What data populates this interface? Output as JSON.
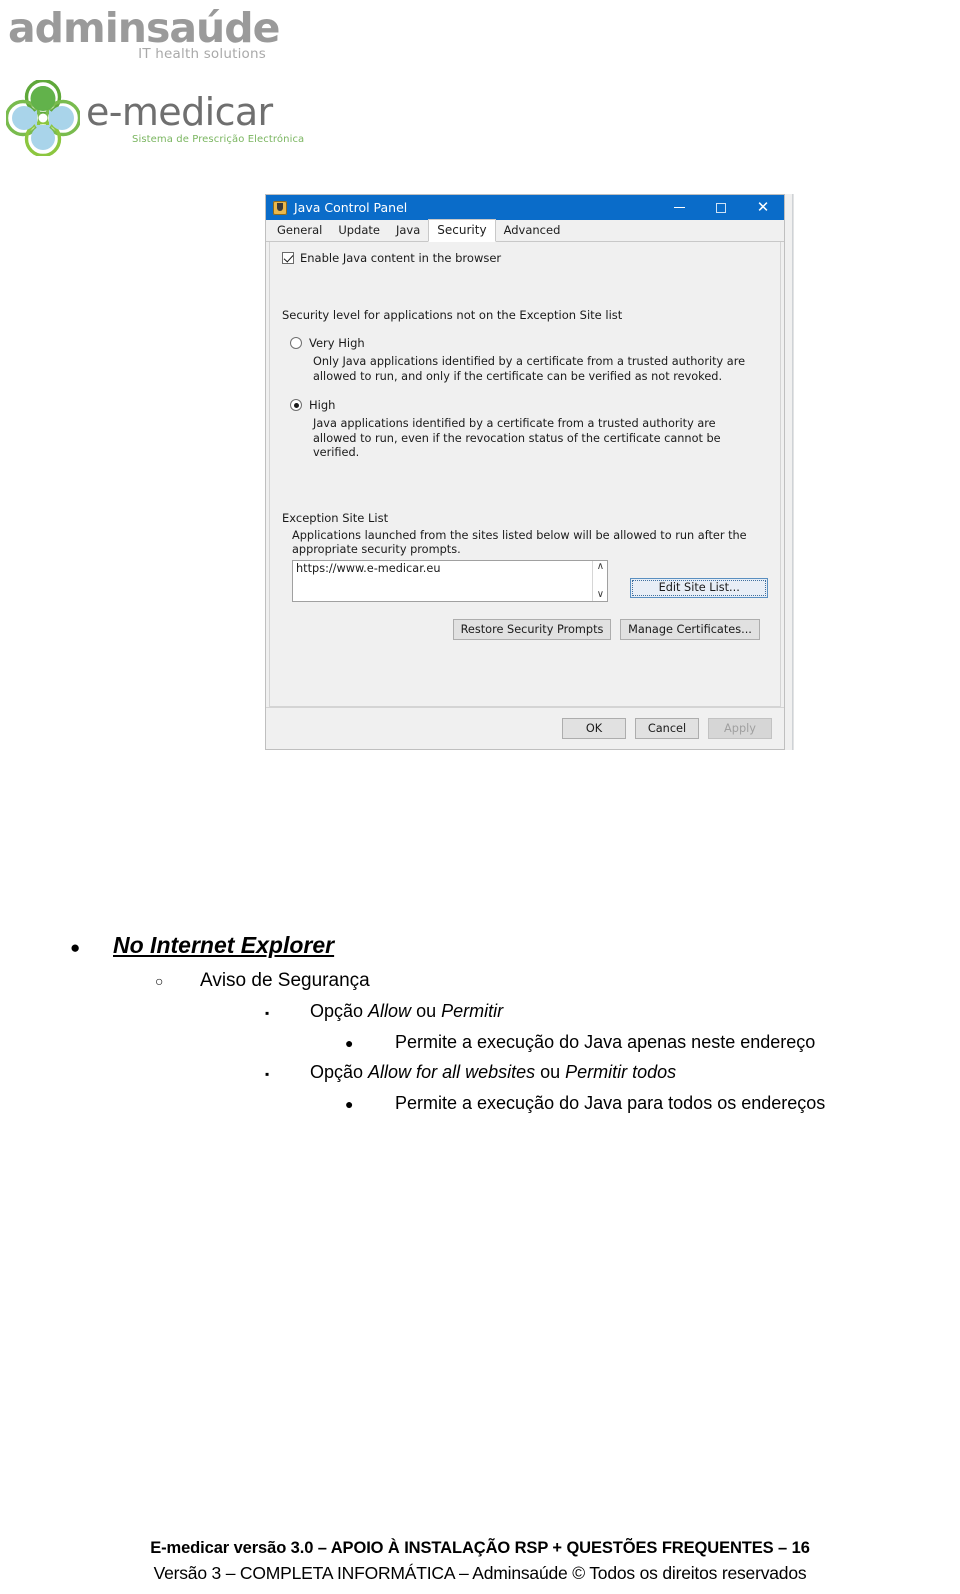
{
  "logos": {
    "adminsaude": {
      "brand": "adminsaúde",
      "tagline": "IT health solutions",
      "color": "#9a9a9a"
    },
    "emedicar": {
      "word": "e-medicar",
      "subtitle": "Sistema de Prescrição Electrónica",
      "mark_icon": "four-petal-flower-icon",
      "petal_green": "#6cb33f",
      "petal_blue": "#9ccfe8",
      "ring_green": "#5fa83a",
      "word_color": "#6f6f6f",
      "subtitle_color": "#7bb661"
    }
  },
  "java_control_panel": {
    "title": "Java Control Panel",
    "title_icon": "java-coffee-cup-icon",
    "titlebar_color": "#0a6cc9",
    "window_buttons": {
      "minimize": "minimize-icon",
      "maximize": "maximize-icon",
      "close": "✕"
    },
    "tabs": [
      {
        "label": "General",
        "active": false
      },
      {
        "label": "Update",
        "active": false
      },
      {
        "label": "Java",
        "active": false
      },
      {
        "label": "Security",
        "active": true
      },
      {
        "label": "Advanced",
        "active": false
      }
    ],
    "enable_java": {
      "label": "Enable Java content in the browser",
      "checked": true
    },
    "security_level": {
      "heading": "Security level for applications not on the Exception Site list",
      "options": [
        {
          "label": "Very High",
          "selected": false,
          "description": "Only Java applications identified by a certificate from a trusted authority are allowed to run, and only if the certificate can be verified as not revoked."
        },
        {
          "label": "High",
          "selected": true,
          "description": "Java applications identified by a certificate from a trusted authority are allowed to run, even if the revocation status of the certificate cannot be verified."
        }
      ]
    },
    "exception_site_list": {
      "heading": "Exception Site List",
      "description": "Applications launched from the sites listed below will be allowed to run after the appropriate security prompts.",
      "sites": [
        "https://www.e-medicar.eu"
      ],
      "scroll_up_icon": "∧",
      "scroll_down_icon": "∨",
      "edit_button": "Edit Site List..."
    },
    "buttons": {
      "restore": "Restore Security Prompts",
      "manage_certificates": "Manage Certificates...",
      "ok": "OK",
      "cancel": "Cancel",
      "apply": "Apply",
      "apply_disabled": true
    }
  },
  "outline": {
    "level1": {
      "bullet": "●",
      "text": "No Internet Explorer"
    },
    "level2": {
      "bullet": "○",
      "text": "Aviso de Segurança"
    },
    "items": [
      {
        "bullet": "▪",
        "prefix": "Opção ",
        "em1": "Allow",
        "mid": " ou ",
        "em2": "Permitir",
        "sub_bullet": "●",
        "sub_text": "Permite a execução do Java apenas neste endereço"
      },
      {
        "bullet": "▪",
        "prefix": "Opção ",
        "em1": "Allow for all websites",
        "mid": " ou ",
        "em2": "Permitir todos",
        "sub_bullet": "●",
        "sub_text": "Permite a execução do Java para todos os endereços"
      }
    ]
  },
  "footer": {
    "line1": "E-medicar versão 3.0 – APOIO À INSTALAÇÃO RSP + QUESTÕES FREQUENTES – 16",
    "line2": "Versão 3 – COMPLETA INFORMÁTICA – Adminsaúde © Todos os direitos reservados"
  }
}
